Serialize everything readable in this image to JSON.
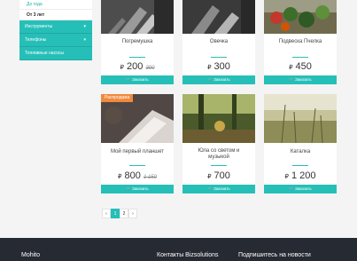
{
  "sidebar": {
    "sub_items": [
      {
        "label": "До года",
        "active": false
      },
      {
        "label": "От 3 лет",
        "active": true
      }
    ],
    "categories": [
      {
        "label": "Инструменты",
        "chevron": "chevron-down-icon"
      },
      {
        "label": "Телефоны",
        "chevron": "chevron-down-icon"
      },
      {
        "label": "Топливные насосы",
        "chevron": ""
      }
    ]
  },
  "products": [
    {
      "name": "Погремушка",
      "name2": "",
      "currency": "₽",
      "price": "200",
      "old_price": "300",
      "button": "Заказать",
      "badge": ""
    },
    {
      "name": "Овечка",
      "name2": "",
      "currency": "₽",
      "price": "300",
      "old_price": "",
      "button": "Заказать",
      "badge": ""
    },
    {
      "name": "Подвеска Пчелка",
      "name2": "",
      "currency": "₽",
      "price": "450",
      "old_price": "",
      "button": "Заказать",
      "badge": ""
    },
    {
      "name": "Мой первый планшет",
      "name2": "",
      "currency": "₽",
      "price": "800",
      "old_price": "1 150",
      "button": "Заказать",
      "badge": "Распродажа"
    },
    {
      "name": "Юла со светом и",
      "name2": "музыкой",
      "currency": "₽",
      "price": "700",
      "old_price": "",
      "button": "Заказать",
      "badge": ""
    },
    {
      "name": "Каталка",
      "name2": "",
      "currency": "₽",
      "price": "1 200",
      "old_price": "",
      "button": "Заказать",
      "badge": ""
    }
  ],
  "pagination": {
    "prev": "‹",
    "pages": [
      "1",
      "2"
    ],
    "current": "1",
    "next": "›"
  },
  "footer": {
    "col1": "Mohito",
    "col2": "Контакты Bizsolutions",
    "col3": "Подпишитесь на новости"
  },
  "colors": {
    "accent": "#26bfb8",
    "badge": "#f08a3c",
    "footer": "#262a33"
  }
}
